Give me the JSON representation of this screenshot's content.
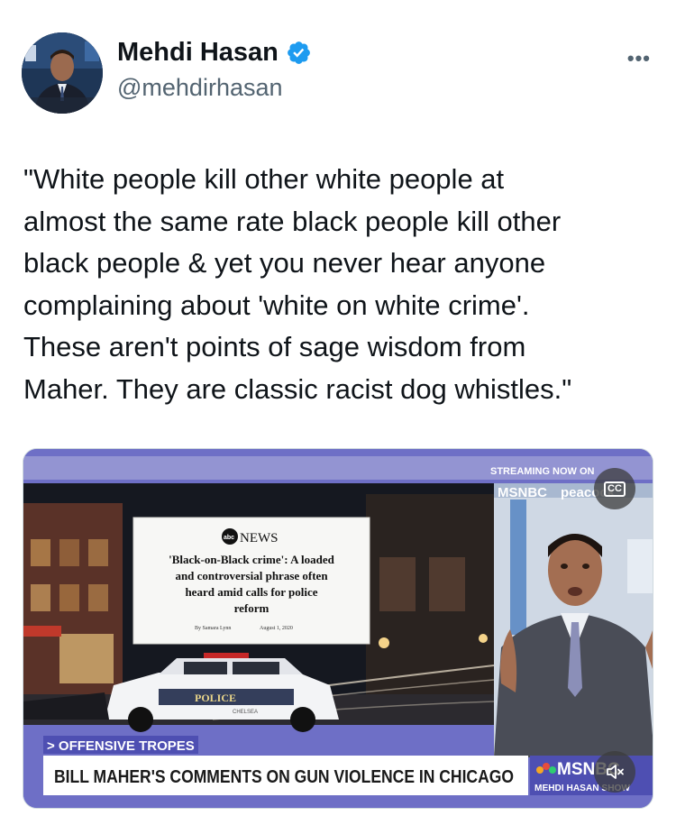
{
  "author": {
    "name": "Mehdi Hasan",
    "handle": "@mehdirhasan",
    "verified": true,
    "avatar_icon": "avatar-photo",
    "more_label": "•••"
  },
  "tweet": {
    "text_lines": [
      "\"White people kill other white people at",
      "almost the same rate black people kill other",
      "black people & yet you never hear anyone",
      "complaining about 'white on white crime'.",
      "These aren't points of sage wisdom from",
      "Maher. They are classic racist dog whistles.\""
    ]
  },
  "video": {
    "streaming_label": "STREAMING NOW ON",
    "network_label": "MSNBC",
    "peacock_label": "peacock",
    "article_source": "NEWS",
    "article_headline_lines": [
      "'Black-on-Black crime': A loaded",
      "and controversial phrase often",
      "heard amid calls for police",
      "reform"
    ],
    "article_byline": "By Samara Lynn",
    "article_date": "August 1, 2020",
    "tag_label": "> OFFENSIVE TROPES",
    "lower_third": "BILL MAHER'S COMMENTS ON GUN VIOLENCE IN CHICAGO",
    "show_network": "MSNBC",
    "show_name": "MEHDI HASAN SHOW",
    "police_text": "POLICE",
    "car_text": "CHELSEA",
    "cc_label": "CC",
    "colors": {
      "frame": "#6e6fc6",
      "lower_third_bg": "#ffffff",
      "tag_bg": "#4e4fb2",
      "accent": "#1d9bf0"
    }
  }
}
